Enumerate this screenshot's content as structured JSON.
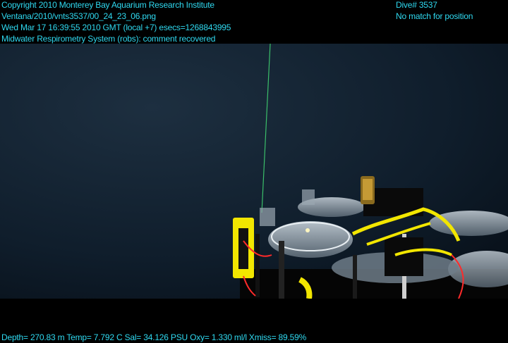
{
  "overlay": {
    "top_left": [
      "Copyright 2010 Monterey Bay Aquarium Research Institute",
      "Ventana/2010/vnts3537/00_24_23_06.png",
      "Wed Mar 17 16:39:55 2010 GMT (local +7)  esecs=1268843995",
      "Midwater Respirometry System (robs): comment recovered"
    ],
    "top_right": [
      "Dive# 3537",
      "No match for position"
    ],
    "bottom": "Depth= 270.83 m  Temp= 7.792 C  Sal= 34.126 PSU  Oxy= 1.330 ml/l  Xmiss= 89.59%",
    "text_color": "#2fd9f0"
  },
  "scene": {
    "description_colors": {
      "water": "#0d1b28",
      "float": "#f2e600",
      "cable": "#ff2a2a"
    }
  }
}
